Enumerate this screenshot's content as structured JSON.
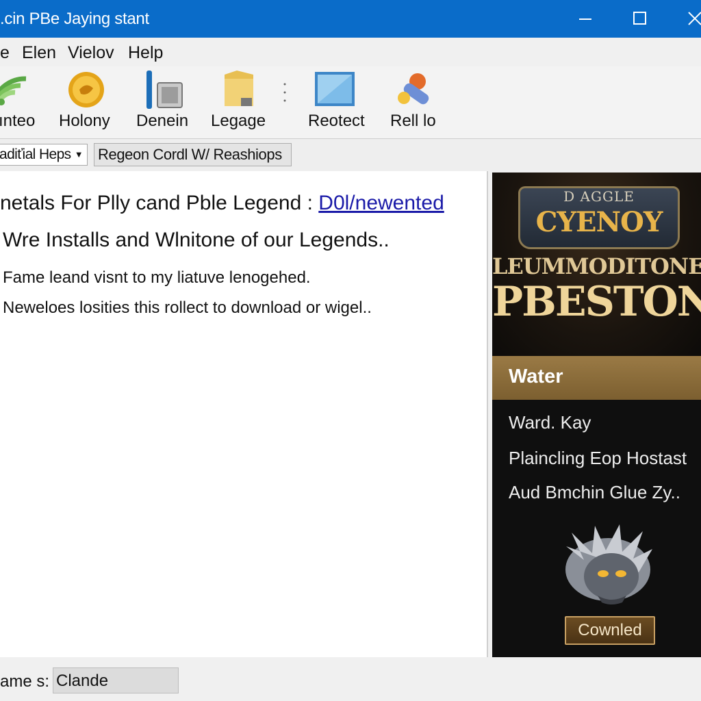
{
  "window": {
    "title": ".cin PBe Jaying stant",
    "titlebar_color": "#0a6cc9"
  },
  "menu": [
    "e",
    "Elen",
    "Vielov",
    "Help"
  ],
  "toolbar": [
    {
      "label": "ınteo",
      "icon": "wifi-signal-icon"
    },
    {
      "label": "Holony",
      "icon": "gold-coin-icon"
    },
    {
      "label": "Denein",
      "icon": "pen-device-icon"
    },
    {
      "label": "Legage",
      "icon": "folder-icon"
    },
    {
      "label": "Reotect",
      "icon": "screen-icon"
    },
    {
      "label": "Rell lo",
      "icon": "tools-icon"
    }
  ],
  "address": {
    "dropdown_value": "adiťial Heps",
    "button_label": "Regeon Cordl W/ Reashiops"
  },
  "content": {
    "line1_text": "netals For Plly cand Pble Legend :",
    "line1_link": "D0l/newented",
    "line2": "Wre Installs and Wlnitone of our Legends..",
    "line3": "Fame leand visnt to my liatuve lenogehed.",
    "line4": "Neweloes losities this rollect to download or wigel.."
  },
  "game_panel": {
    "logo_top": "D AGGLE",
    "logo_main": "CYENOY",
    "banner_line1": "LEUMMODITONE",
    "banner_line2": "PBESTONE",
    "section_title": "Water",
    "info": [
      "Ward. Kay",
      "Plaincling Eop Hostast",
      "Aud Bmchin Glue Zy.."
    ],
    "button_label": "Cownled",
    "accent_color": "#9a7a45"
  },
  "status": {
    "label": "ame s:",
    "value": "Clande"
  }
}
